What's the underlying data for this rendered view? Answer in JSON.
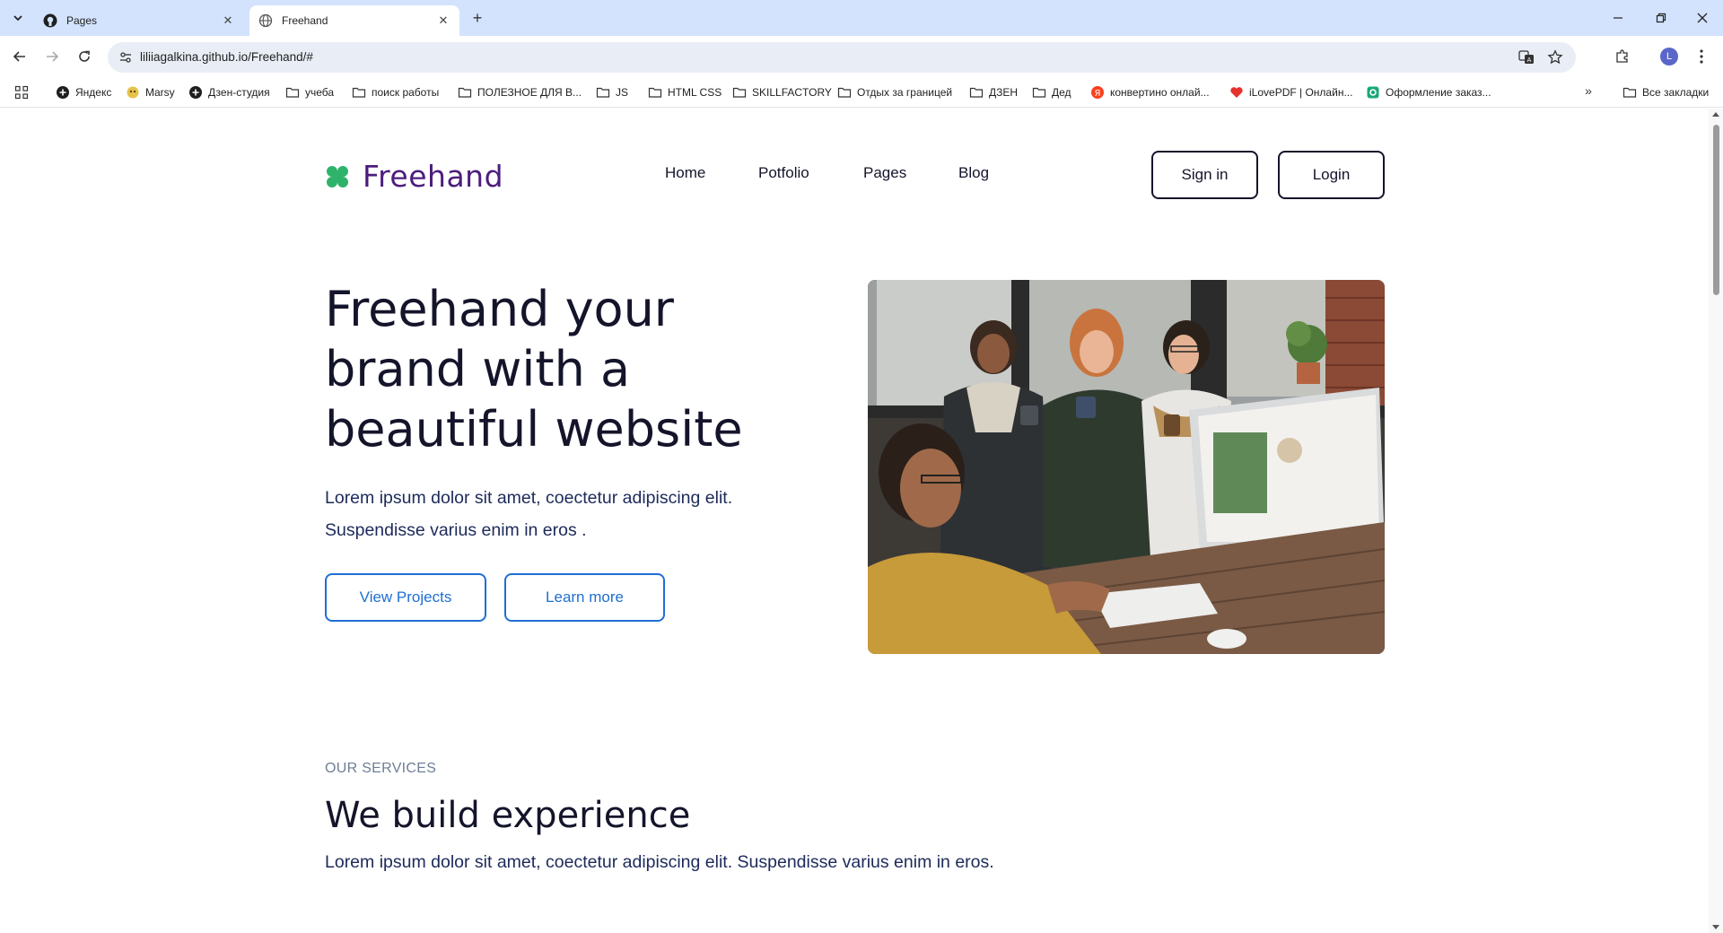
{
  "browser": {
    "tabs": [
      {
        "title": "Pages",
        "favicon": "github-icon"
      },
      {
        "title": "Freehand",
        "favicon": "globe-icon"
      }
    ],
    "url": "liliiagalkina.github.io/Freehand/#",
    "profile_initial": "L",
    "bookmarks": [
      {
        "label": "Яндекс",
        "icon": "plus-circle-icon"
      },
      {
        "label": "Marsy",
        "icon": "marsy-icon"
      },
      {
        "label": "Дзен-студия",
        "icon": "plus-circle-icon"
      },
      {
        "label": "учеба",
        "icon": "folder-icon"
      },
      {
        "label": "поиск работы",
        "icon": "folder-icon"
      },
      {
        "label": "ПОЛЕЗНОЕ ДЛЯ В...",
        "icon": "folder-icon"
      },
      {
        "label": "JS",
        "icon": "folder-icon"
      },
      {
        "label": "HTML CSS",
        "icon": "folder-icon"
      },
      {
        "label": "SKILLFACTORY",
        "icon": "folder-icon"
      },
      {
        "label": "Отдых за границей",
        "icon": "folder-icon"
      },
      {
        "label": "ДЗЕН",
        "icon": "folder-icon"
      },
      {
        "label": "Дед",
        "icon": "folder-icon"
      },
      {
        "label": "конвертино онлай...",
        "icon": "yandex-icon"
      },
      {
        "label": "iLovePDF | Онлайн...",
        "icon": "heart-icon"
      },
      {
        "label": "Оформление заказ...",
        "icon": "green-square-icon"
      }
    ],
    "all_bookmarks": "Все закладки"
  },
  "site": {
    "brand": "Freehand",
    "nav": [
      "Home",
      "Potfolio",
      "Pages",
      "Blog"
    ],
    "signin_label": "Sign in",
    "login_label": "Login",
    "hero": {
      "title": "Freehand your brand with a beautiful website",
      "text": "Lorem ipsum dolor sit amet, coectetur adipiscing elit. Suspendisse varius enim in eros .",
      "primary_btn": "View Projects",
      "secondary_btn": "Learn more"
    },
    "services": {
      "eyebrow": "OUR SERVICES",
      "title": "We build experience",
      "text": "Lorem ipsum dolor sit amet, coectetur adipiscing elit. Suspendisse varius enim in eros."
    }
  },
  "colors": {
    "brand_purple": "#4c1d7d",
    "brand_green": "#2fb36b",
    "heading": "#14142b",
    "accent_blue": "#1f6fd1"
  }
}
